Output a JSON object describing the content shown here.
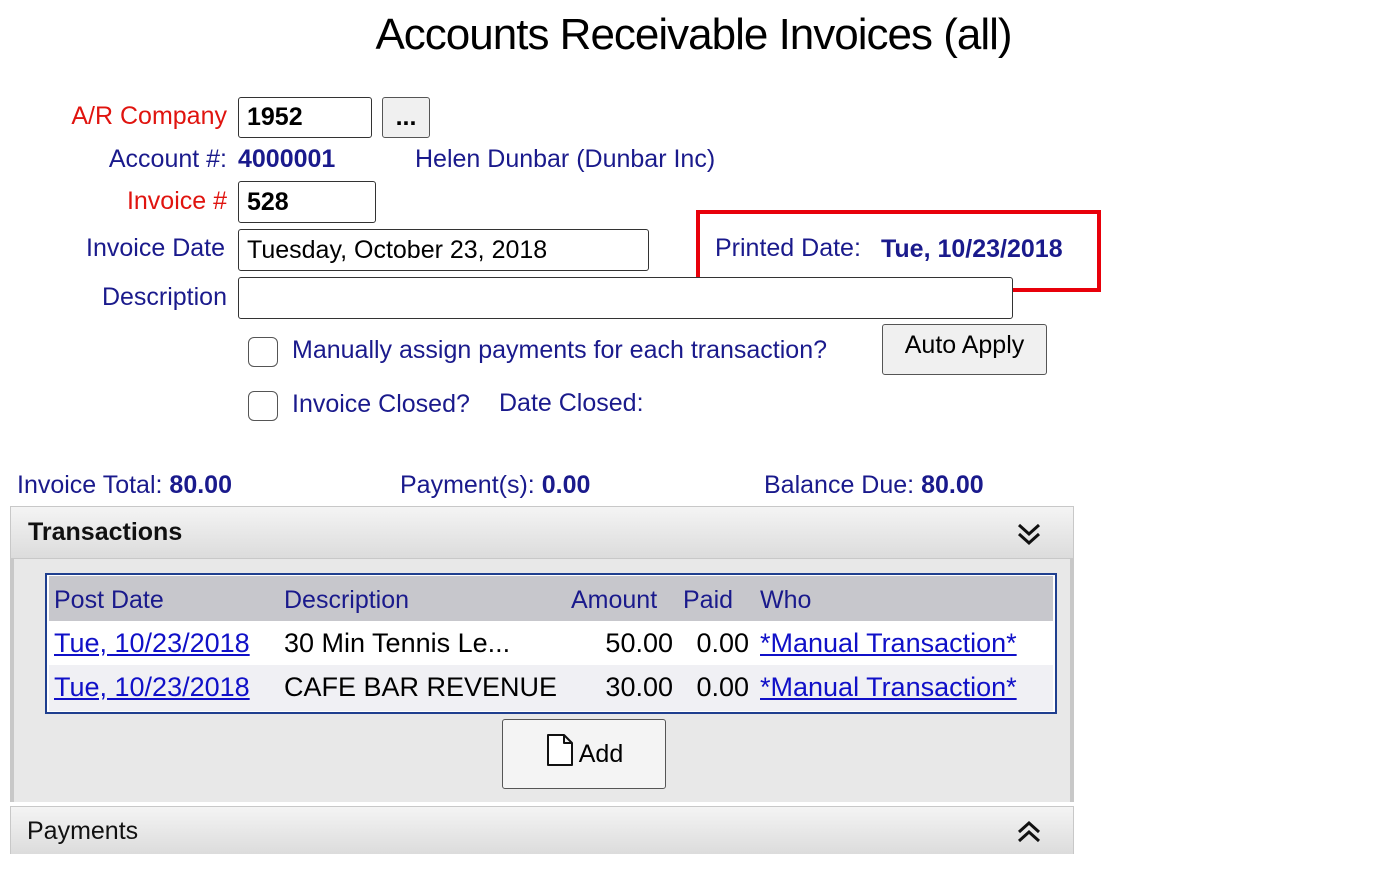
{
  "page": {
    "title": "Accounts Receivable Invoices (all)"
  },
  "form": {
    "company_label": "A/R Company",
    "company_value": "1952",
    "browse_label": "...",
    "account_label": "Account #:",
    "account_value": "4000001",
    "account_name": "Helen Dunbar (Dunbar Inc)",
    "invoice_label": "Invoice #",
    "invoice_value": "528",
    "invoice_date_label": "Invoice Date",
    "invoice_date_value": "Tuesday, October 23, 2018",
    "printed_date_label": "Printed Date:",
    "printed_date_value": "Tue, 10/23/2018",
    "description_label": "Description",
    "description_value": "",
    "manual_assign_label": "Manually assign payments for each transaction?",
    "auto_apply_label": "Auto Apply",
    "invoice_closed_label": "Invoice Closed?",
    "date_closed_label": "Date Closed:"
  },
  "totals": {
    "invoice_total_label": "Invoice Total:",
    "invoice_total_value": "80.00",
    "payments_label": "Payment(s):",
    "payments_value": "0.00",
    "balance_label": "Balance Due:",
    "balance_value": "80.00"
  },
  "transactions": {
    "header": "Transactions",
    "columns": [
      "Post Date",
      "Description",
      "Amount",
      "Paid",
      "Who"
    ],
    "rows": [
      {
        "post_date": "Tue, 10/23/2018",
        "description": "30 Min Tennis Le...",
        "amount": "50.00",
        "paid": "0.00",
        "who": "*Manual Transaction*"
      },
      {
        "post_date": "Tue, 10/23/2018",
        "description": "CAFE BAR REVENUE",
        "amount": "30.00",
        "paid": "0.00",
        "who": "*Manual Transaction*"
      }
    ],
    "add_label": "Add"
  },
  "payments": {
    "header": "Payments"
  },
  "colors": {
    "label_red": "#e0140f",
    "label_blue": "#1a1a8c",
    "link": "#1010c8",
    "highlight_box": "#e8000a"
  },
  "icons": [
    "ellipsis",
    "chevron-double-down-icon",
    "chevron-double-up-icon",
    "document-icon"
  ]
}
